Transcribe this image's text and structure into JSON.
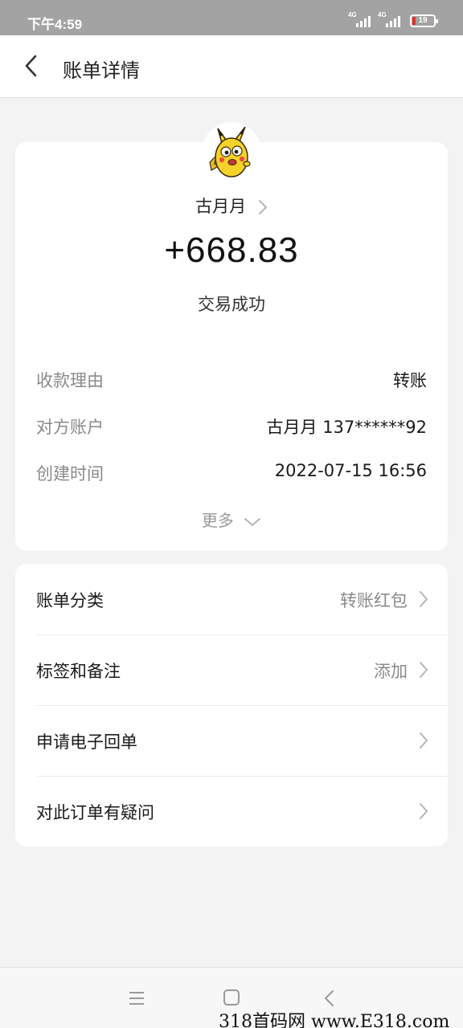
{
  "status_bar": {
    "time": "下午4:59",
    "signal_1": "4G",
    "signal_2": "4G",
    "battery": "19"
  },
  "header": {
    "title": "账单详情",
    "back_icon": "chevron-left-icon"
  },
  "transaction": {
    "avatar": "pikachu-avatar",
    "counterparty": "古月月",
    "amount": "+668.83",
    "status": "交易成功",
    "details": [
      {
        "label": "收款理由",
        "value": "转账"
      },
      {
        "label": "对方账户",
        "value": "古月月 137******92"
      },
      {
        "label": "创建时间",
        "value": "2022-07-15 16:56"
      }
    ],
    "more_label": "更多"
  },
  "menu": {
    "items": [
      {
        "label": "账单分类",
        "value": "转账红包"
      },
      {
        "label": "标签和备注",
        "value": "添加"
      },
      {
        "label": "申请电子回单",
        "value": ""
      },
      {
        "label": "对此订单有疑问",
        "value": ""
      }
    ]
  },
  "nav_bar": {
    "buttons": [
      "menu-icon",
      "home-square-icon",
      "back-triangle-icon"
    ]
  },
  "watermark": "318首码网 www.E318.com",
  "colors": {
    "status_bar": "#a3a3a3",
    "background": "#f3f3f3",
    "card": "#ffffff",
    "label_gray": "#8a8a8a",
    "battery_low": "#e0312b"
  }
}
